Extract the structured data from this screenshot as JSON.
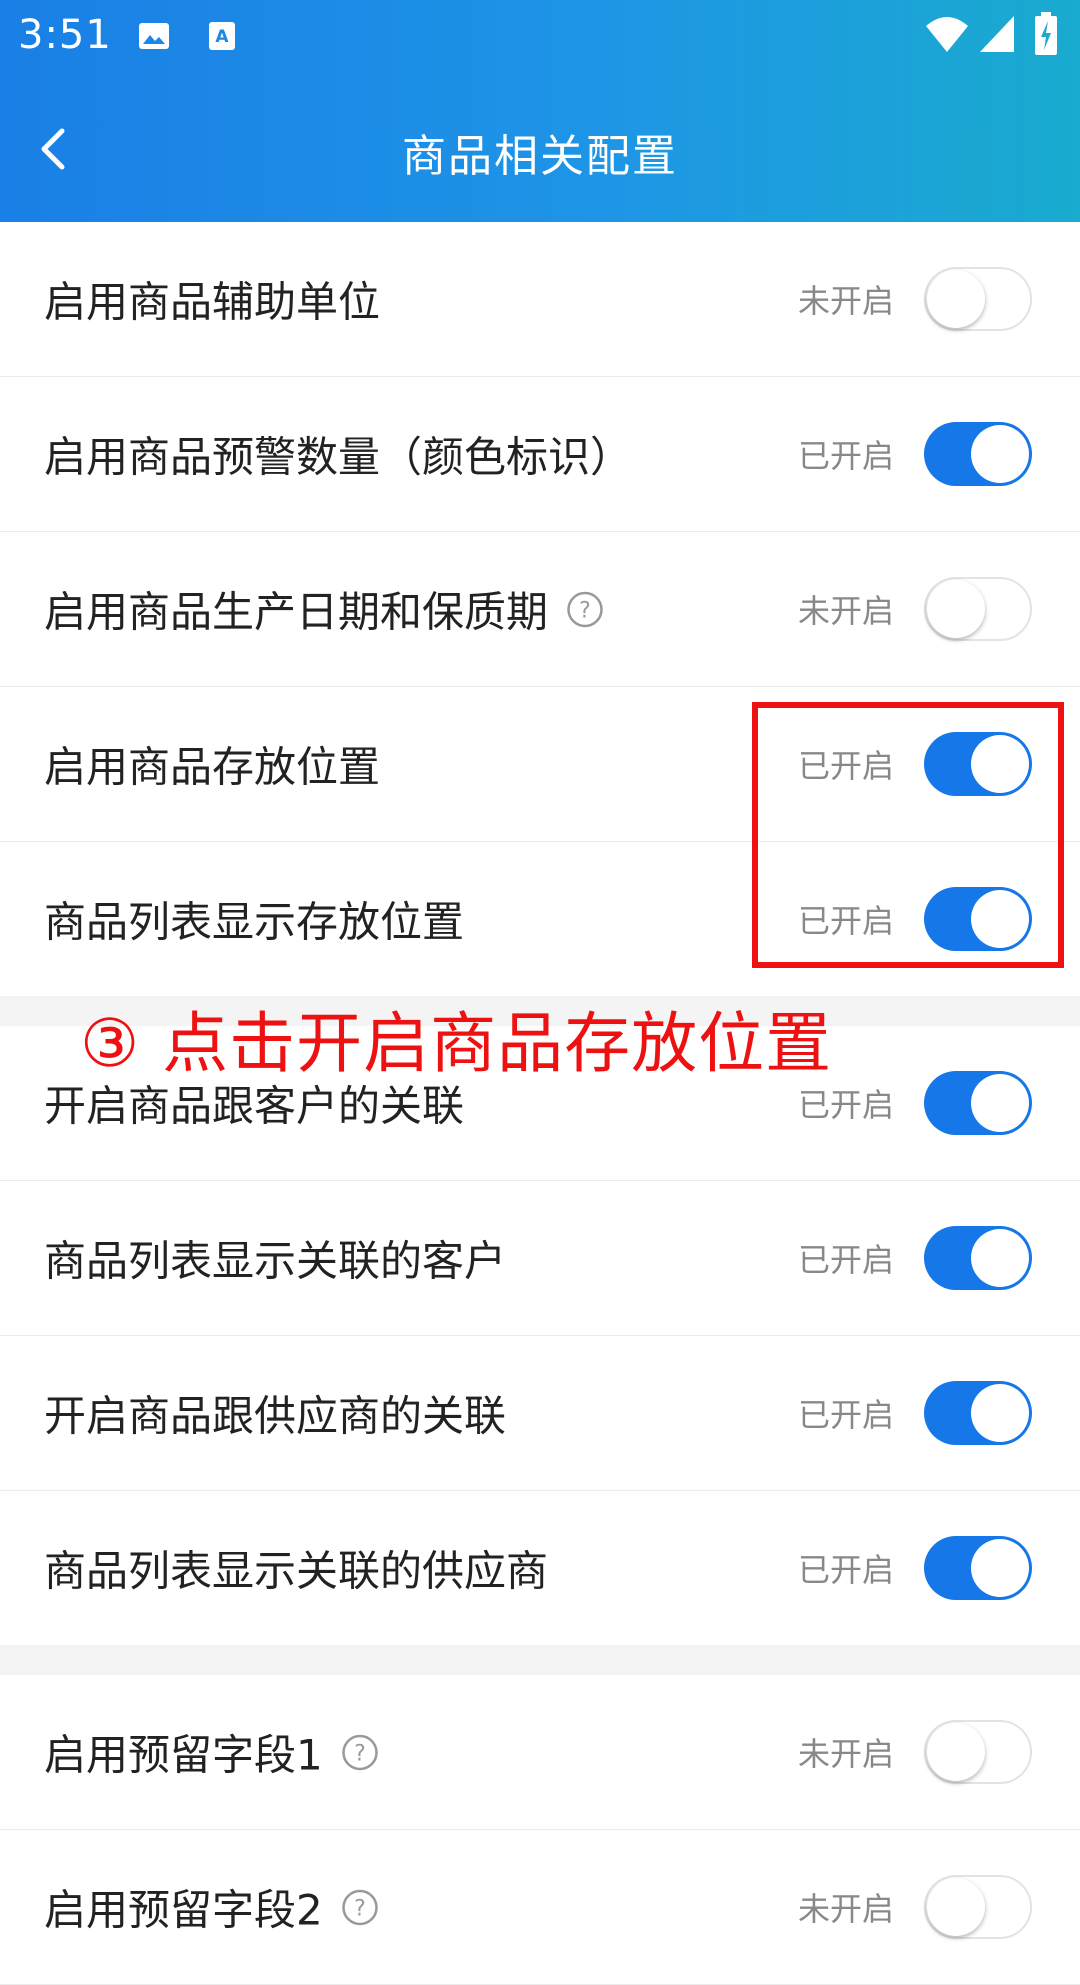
{
  "status_bar": {
    "time": "3:51",
    "icons": [
      "image-icon",
      "keyboard-icon",
      "wifi-icon",
      "signal-icon",
      "battery-icon"
    ]
  },
  "nav": {
    "title": "商品相关配置",
    "back_icon": "chevron-left-icon"
  },
  "colors": {
    "header_start": "#1a7fe6",
    "header_end": "#1aabcf",
    "toggle_on": "#1577e8",
    "annotation": "#ee1111"
  },
  "settings": [
    {
      "label": "启用商品辅助单位",
      "status": "未开启",
      "on": false,
      "help": false
    },
    {
      "label": "启用商品预警数量（颜色标识）",
      "status": "已开启",
      "on": true,
      "help": false
    },
    {
      "label": "启用商品生产日期和保质期",
      "status": "未开启",
      "on": false,
      "help": true
    },
    {
      "label": "启用商品存放位置",
      "status": "已开启",
      "on": true,
      "help": false
    },
    {
      "label": "商品列表显示存放位置",
      "status": "已开启",
      "on": true,
      "help": false
    },
    {
      "label": "开启商品跟客户的关联",
      "status": "已开启",
      "on": true,
      "help": false
    },
    {
      "label": "商品列表显示关联的客户",
      "status": "已开启",
      "on": true,
      "help": false
    },
    {
      "label": "开启商品跟供应商的关联",
      "status": "已开启",
      "on": true,
      "help": false
    },
    {
      "label": "商品列表显示关联的供应商",
      "status": "已开启",
      "on": true,
      "help": false
    },
    {
      "label": "启用预留字段1",
      "status": "未开启",
      "on": false,
      "help": true
    },
    {
      "label": "启用预留字段2",
      "status": "未开启",
      "on": false,
      "help": true
    }
  ],
  "annotation": {
    "text": "③ 点击开启商品存放位置"
  }
}
